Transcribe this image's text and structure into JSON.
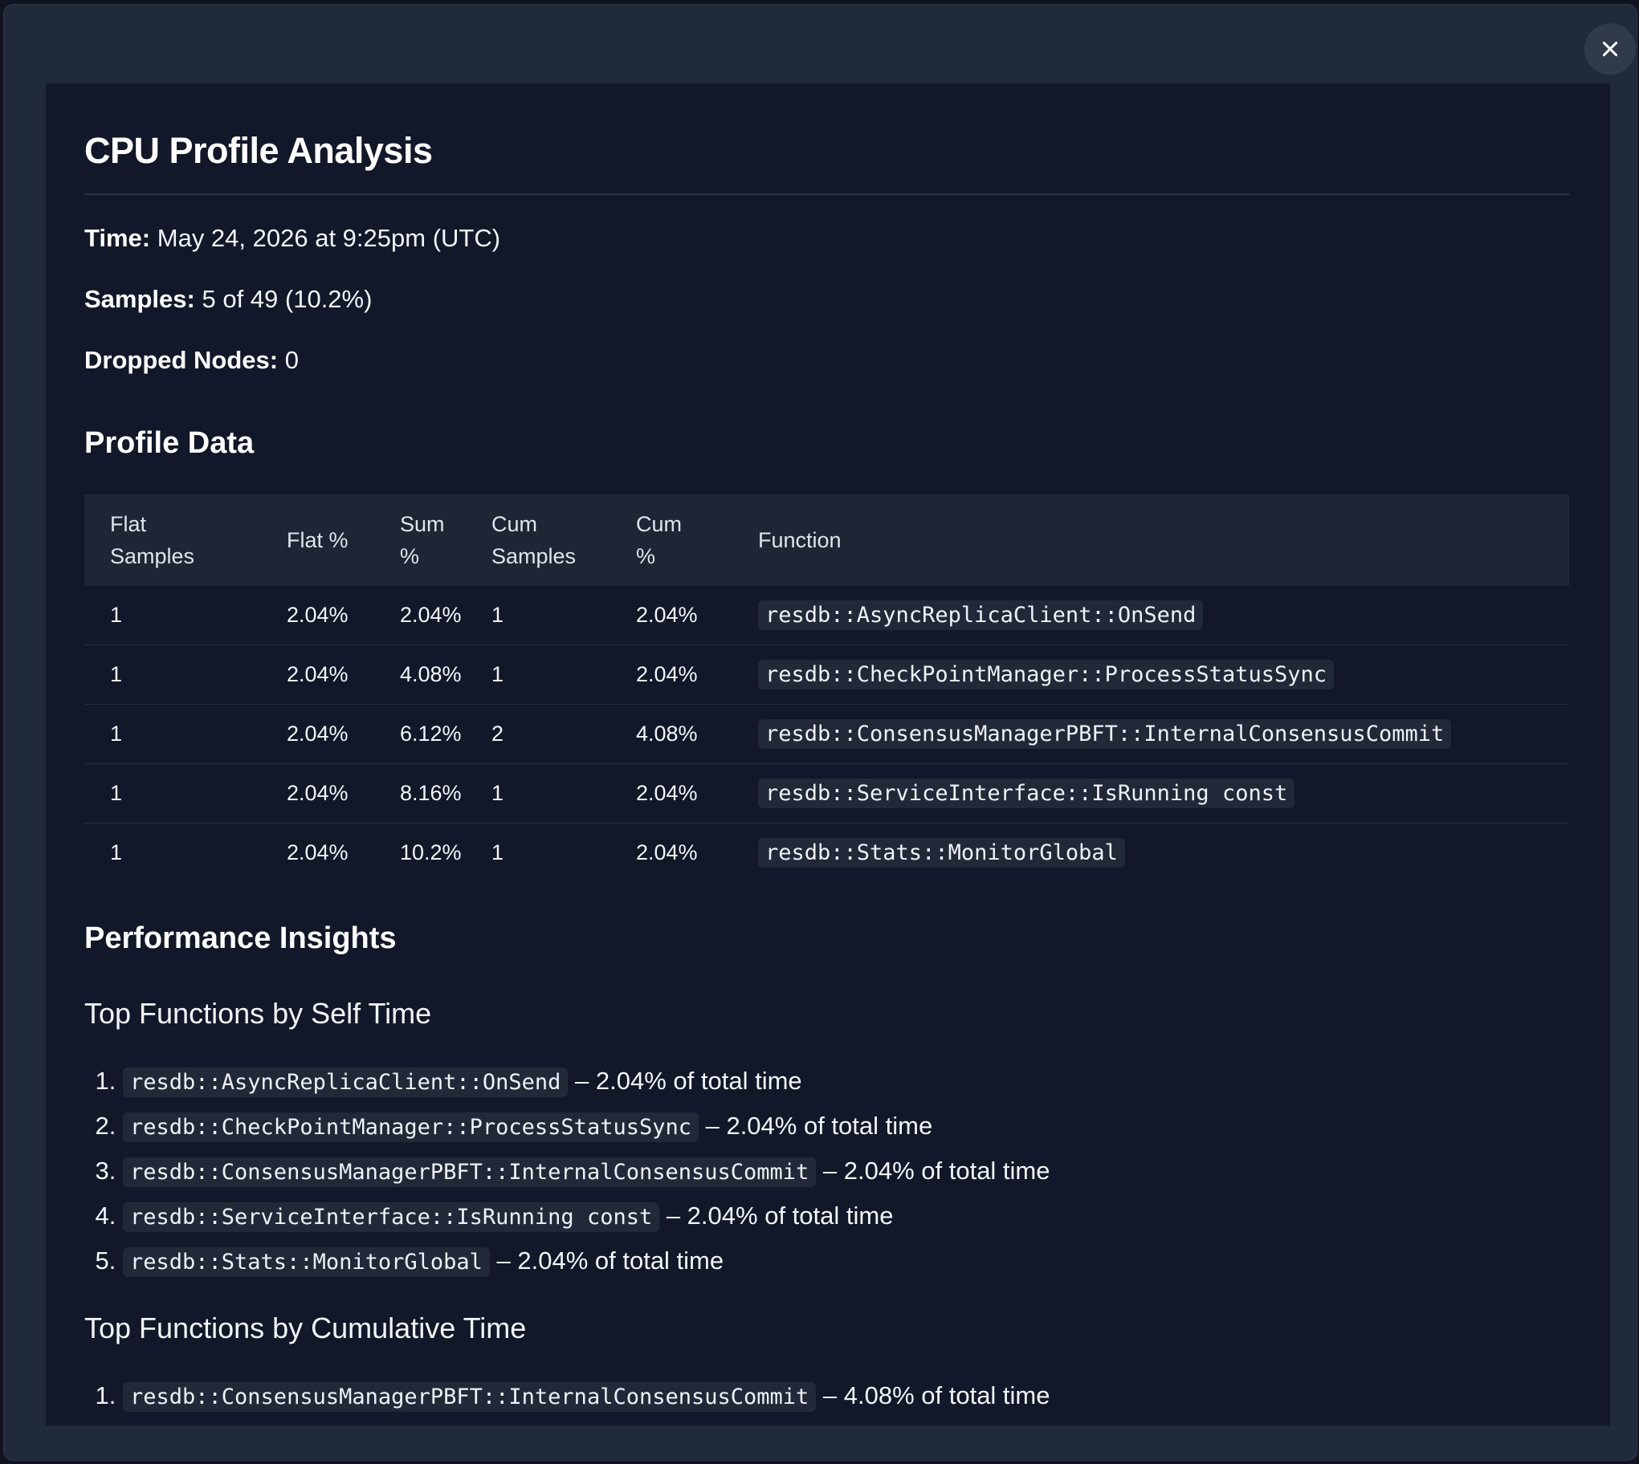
{
  "dialog": {
    "close_label": "×"
  },
  "report": {
    "title": "CPU Profile Analysis",
    "time_label": "Time:",
    "time_value": "May 24, 2026 at 9:25pm (UTC)",
    "samples_label": "Samples:",
    "samples_value": "5 of 49 (10.2%)",
    "dropped_label": "Dropped Nodes:",
    "dropped_value": "0"
  },
  "profile": {
    "heading": "Profile Data",
    "columns": {
      "flat_samples_1": "Flat",
      "flat_samples_2": "Samples",
      "flat_pct": "Flat %",
      "sum_pct_1": "Sum",
      "sum_pct_2": "%",
      "cum_samples_1": "Cum",
      "cum_samples_2": "Samples",
      "cum_pct_1": "Cum",
      "cum_pct_2": "%",
      "function": "Function"
    },
    "rows": [
      {
        "flat": "1",
        "flat_pct": "2.04%",
        "sum_pct": "2.04%",
        "cum": "1",
        "cum_pct": "2.04%",
        "function": "resdb::AsyncReplicaClient::OnSend"
      },
      {
        "flat": "1",
        "flat_pct": "2.04%",
        "sum_pct": "4.08%",
        "cum": "1",
        "cum_pct": "2.04%",
        "function": "resdb::CheckPointManager::ProcessStatusSync"
      },
      {
        "flat": "1",
        "flat_pct": "2.04%",
        "sum_pct": "6.12%",
        "cum": "2",
        "cum_pct": "4.08%",
        "function": "resdb::ConsensusManagerPBFT::InternalConsensusCommit"
      },
      {
        "flat": "1",
        "flat_pct": "2.04%",
        "sum_pct": "8.16%",
        "cum": "1",
        "cum_pct": "2.04%",
        "function": "resdb::ServiceInterface::IsRunning const"
      },
      {
        "flat": "1",
        "flat_pct": "2.04%",
        "sum_pct": "10.2%",
        "cum": "1",
        "cum_pct": "2.04%",
        "function": "resdb::Stats::MonitorGlobal"
      }
    ]
  },
  "insights": {
    "heading": "Performance Insights",
    "self_time": {
      "heading": "Top Functions by Self Time",
      "items": [
        {
          "function": "resdb::AsyncReplicaClient::OnSend",
          "text": " – 2.04% of total time"
        },
        {
          "function": "resdb::CheckPointManager::ProcessStatusSync",
          "text": " – 2.04% of total time"
        },
        {
          "function": "resdb::ConsensusManagerPBFT::InternalConsensusCommit",
          "text": " – 2.04% of total time"
        },
        {
          "function": "resdb::ServiceInterface::IsRunning const",
          "text": " – 2.04% of total time"
        },
        {
          "function": "resdb::Stats::MonitorGlobal",
          "text": " – 2.04% of total time"
        }
      ]
    },
    "cumulative_time": {
      "heading": "Top Functions by Cumulative Time",
      "items": [
        {
          "function": "resdb::ConsensusManagerPBFT::InternalConsensusCommit",
          "text": " – 4.08% of total time"
        }
      ]
    }
  },
  "colors": {
    "frame": "#212a3a",
    "panel": "#121829",
    "table_header": "#1e2635",
    "code_bg": "#212938"
  }
}
